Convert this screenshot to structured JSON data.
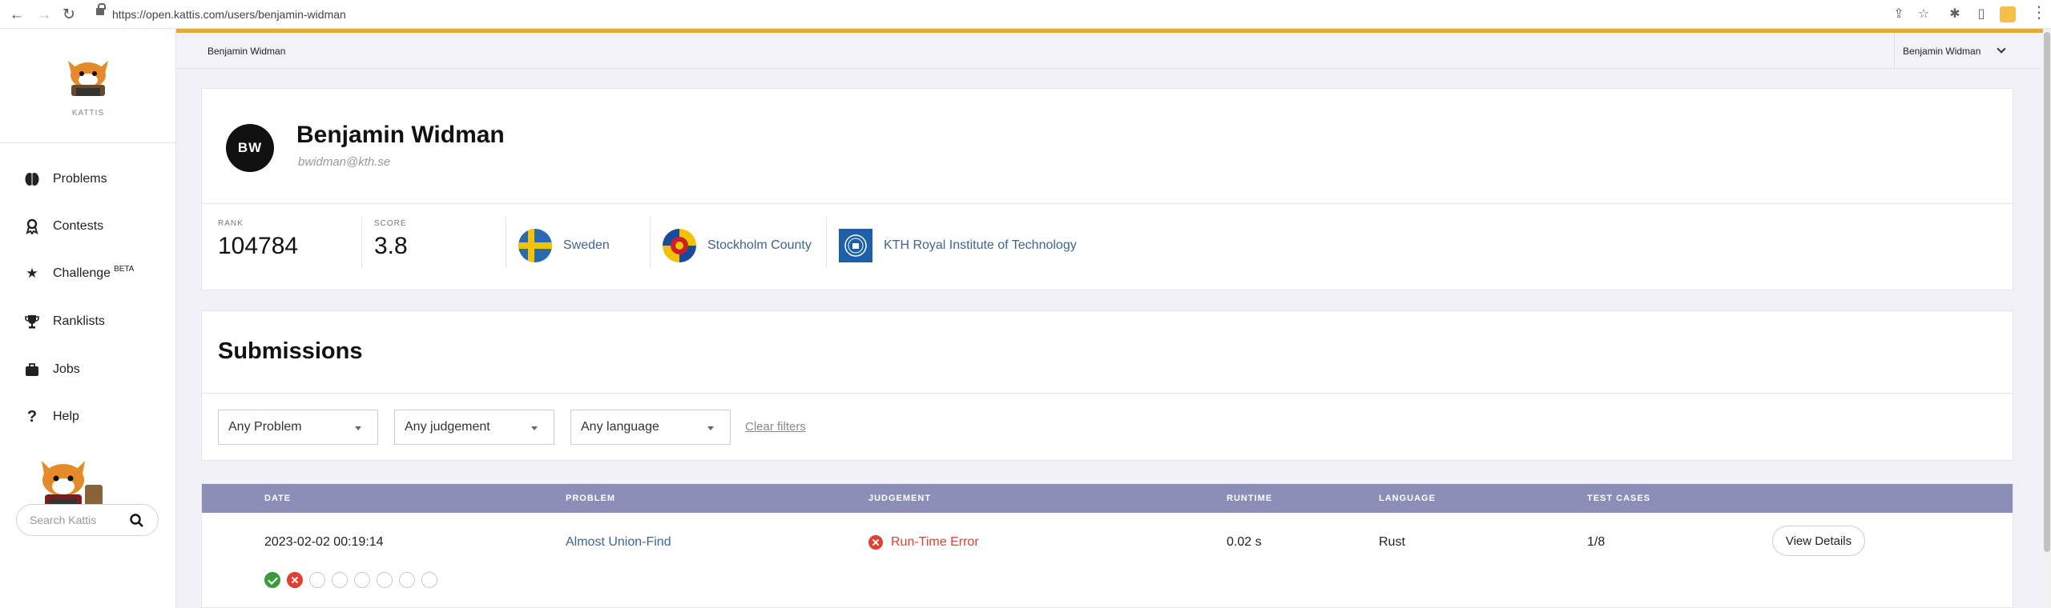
{
  "browser": {
    "url": "https://open.kattis.com/users/benjamin-widman",
    "back_icon": "arrow-left-icon",
    "forward_icon": "arrow-right-icon",
    "reload_icon": "reload-icon"
  },
  "sidebar": {
    "logo_text": "KATTIS",
    "items": [
      {
        "label": "Problems",
        "icon": "brain-icon"
      },
      {
        "label": "Contests",
        "icon": "medal-icon"
      },
      {
        "label": "Challenge",
        "badge": "BETA",
        "icon": "star-icon"
      },
      {
        "label": "Ranklists",
        "icon": "trophy-icon"
      },
      {
        "label": "Jobs",
        "icon": "briefcase-icon"
      },
      {
        "label": "Help",
        "icon": "question-icon"
      }
    ],
    "search_placeholder": "Search Kattis"
  },
  "topbar": {
    "breadcrumb": "Benjamin Widman",
    "user_menu": "Benjamin Widman"
  },
  "profile": {
    "initials": "BW",
    "name": "Benjamin Widman",
    "email": "bwidman@kth.se",
    "rank_label": "RANK",
    "rank": "104784",
    "score_label": "SCORE",
    "score": "3.8",
    "country": "Sweden",
    "region": "Stockholm County",
    "university": "KTH Royal Institute of Technology"
  },
  "submissions": {
    "title": "Submissions",
    "filters": {
      "problem": "Any Problem",
      "judgement": "Any judgement",
      "language": "Any language",
      "clear": "Clear filters"
    },
    "columns": [
      "DATE",
      "PROBLEM",
      "JUDGEMENT",
      "RUNTIME",
      "LANGUAGE",
      "TEST CASES"
    ],
    "rows": [
      {
        "date": "2023-02-02 00:19:14",
        "problem": "Almost Union-Find",
        "judgement": "Run-Time Error",
        "runtime": "0.02 s",
        "language": "Rust",
        "test_cases": "1/8",
        "details": "View Details",
        "case_results": [
          "ok",
          "bad",
          "none",
          "none",
          "none",
          "none",
          "none",
          "none"
        ]
      }
    ]
  },
  "colors": {
    "accent": "#e9a63b",
    "header": "#8b8fb8",
    "link": "#3e6496",
    "error": "#e0402e",
    "success": "#3c9a3c"
  }
}
